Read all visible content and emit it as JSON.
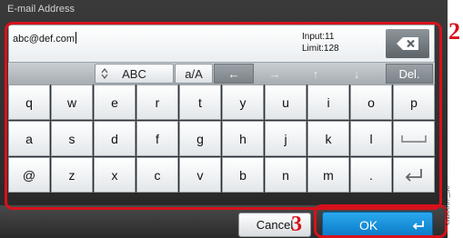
{
  "screen": {
    "title": "E-mail Address",
    "entry_text": "abc@def.com",
    "input_counter": "Input:11",
    "limit_counter": "Limit:128"
  },
  "function_row": {
    "abc_label": "ABC",
    "case_label": "a/A",
    "left_arrow": "←",
    "right_arrow": "→",
    "up_arrow": "↑",
    "down_arrow": "↓",
    "delete_label": "Del."
  },
  "keys": {
    "row1": [
      "q",
      "w",
      "e",
      "r",
      "t",
      "y",
      "u",
      "i",
      "o",
      "p"
    ],
    "row2": [
      "a",
      "s",
      "d",
      "f",
      "g",
      "h",
      "j",
      "k",
      "l",
      ""
    ],
    "row3": [
      "@",
      "z",
      "x",
      "c",
      "v",
      "b",
      "n",
      "m",
      ".",
      ""
    ]
  },
  "buttons": {
    "cancel_label": "Cancel",
    "ok_label": "OK"
  },
  "annotations": {
    "step_2": "2",
    "step_3": "3",
    "figure_id": "GB0057_30"
  },
  "colors": {
    "callout": "#d7111b",
    "ok_button": "#1590dc"
  }
}
